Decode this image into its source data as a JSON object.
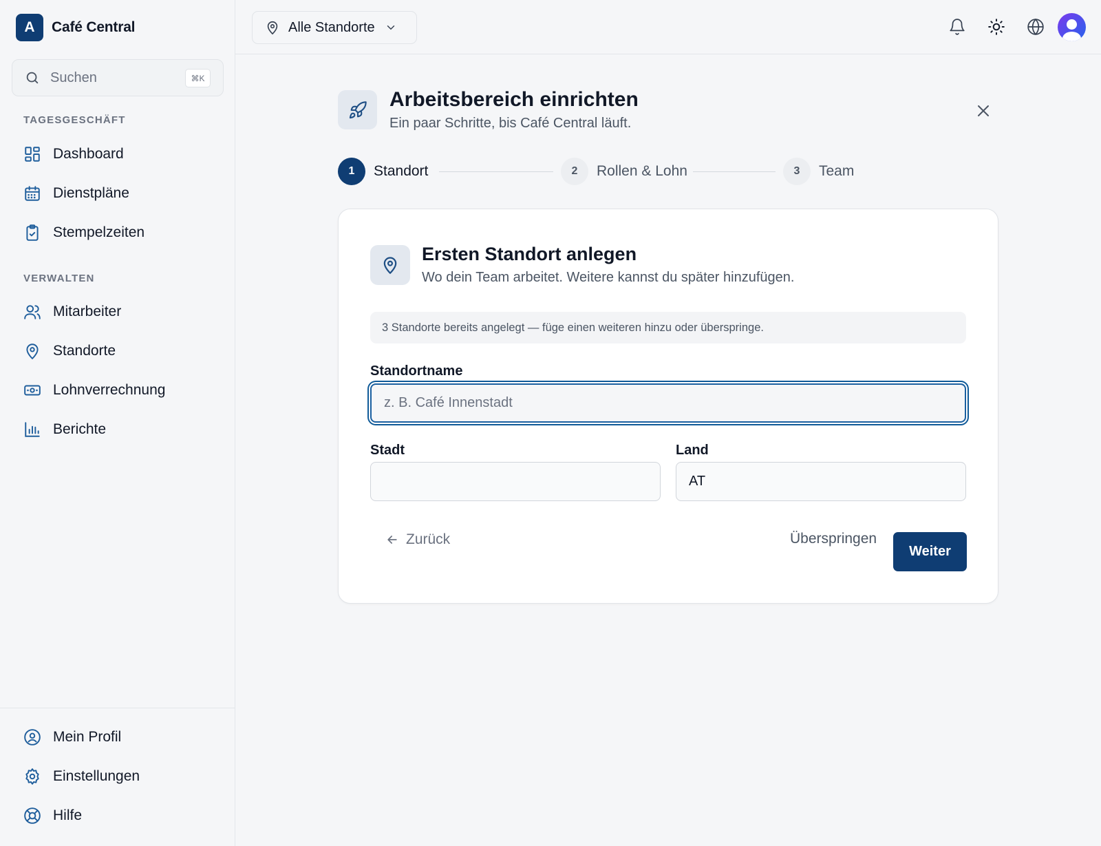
{
  "app": {
    "logo_letter": "A",
    "name": "Café Central",
    "brand_color": "#0f3d73"
  },
  "search": {
    "placeholder": "Suchen",
    "shortcut": "⌘K"
  },
  "sidebar": {
    "sections": [
      {
        "label": "TAGESGESCHÄFT",
        "items": [
          {
            "label": "Dashboard",
            "icon": "dashboard-icon"
          },
          {
            "label": "Dienstpläne",
            "icon": "calendar-icon"
          },
          {
            "label": "Stempelzeiten",
            "icon": "clipboard-check-icon"
          }
        ]
      },
      {
        "label": "VERWALTEN",
        "items": [
          {
            "label": "Mitarbeiter",
            "icon": "users-icon"
          },
          {
            "label": "Standorte",
            "icon": "map-pin-icon"
          },
          {
            "label": "Lohnverrechnung",
            "icon": "banknote-icon"
          },
          {
            "label": "Berichte",
            "icon": "bar-chart-icon"
          }
        ]
      }
    ],
    "footer_items": [
      {
        "label": "Mein Profil",
        "icon": "user-circle-icon"
      },
      {
        "label": "Einstellungen",
        "icon": "gear-icon"
      },
      {
        "label": "Hilfe",
        "icon": "lifebuoy-icon"
      }
    ]
  },
  "topbar": {
    "location_select": "Alle Standorte",
    "icons": [
      "bell-icon",
      "sun-icon",
      "globe-icon",
      "avatar"
    ]
  },
  "wizard": {
    "title": "Arbeitsbereich einrichten",
    "subtitle": "Ein paar Schritte, bis Café Central läuft.",
    "steps": [
      {
        "number": "1",
        "label": "Standort",
        "state": "active"
      },
      {
        "number": "2",
        "label": "Rollen & Lohn",
        "state": "upcoming"
      },
      {
        "number": "3",
        "label": "Team",
        "state": "upcoming"
      }
    ],
    "card": {
      "title": "Ersten Standort anlegen",
      "subtitle": "Wo dein Team arbeitet. Weitere kannst du später hinzufügen.",
      "notice": "3 Standorte bereits angelegt — füge einen weiteren hinzu oder überspringe.",
      "fields": {
        "name_label": "Standortname",
        "name_value": "",
        "name_placeholder": "z. B. Café Innenstadt",
        "city_label": "Stadt",
        "city_value": "",
        "country_label": "Land",
        "country_value": "AT"
      },
      "back_label": "Zurück",
      "skip_label": "Überspringen",
      "next_label": "Weiter"
    }
  },
  "colors": {
    "accent": "#0f3d73",
    "icon_blue": "#1f5e9c",
    "focus_ring": "#0f5a98"
  }
}
